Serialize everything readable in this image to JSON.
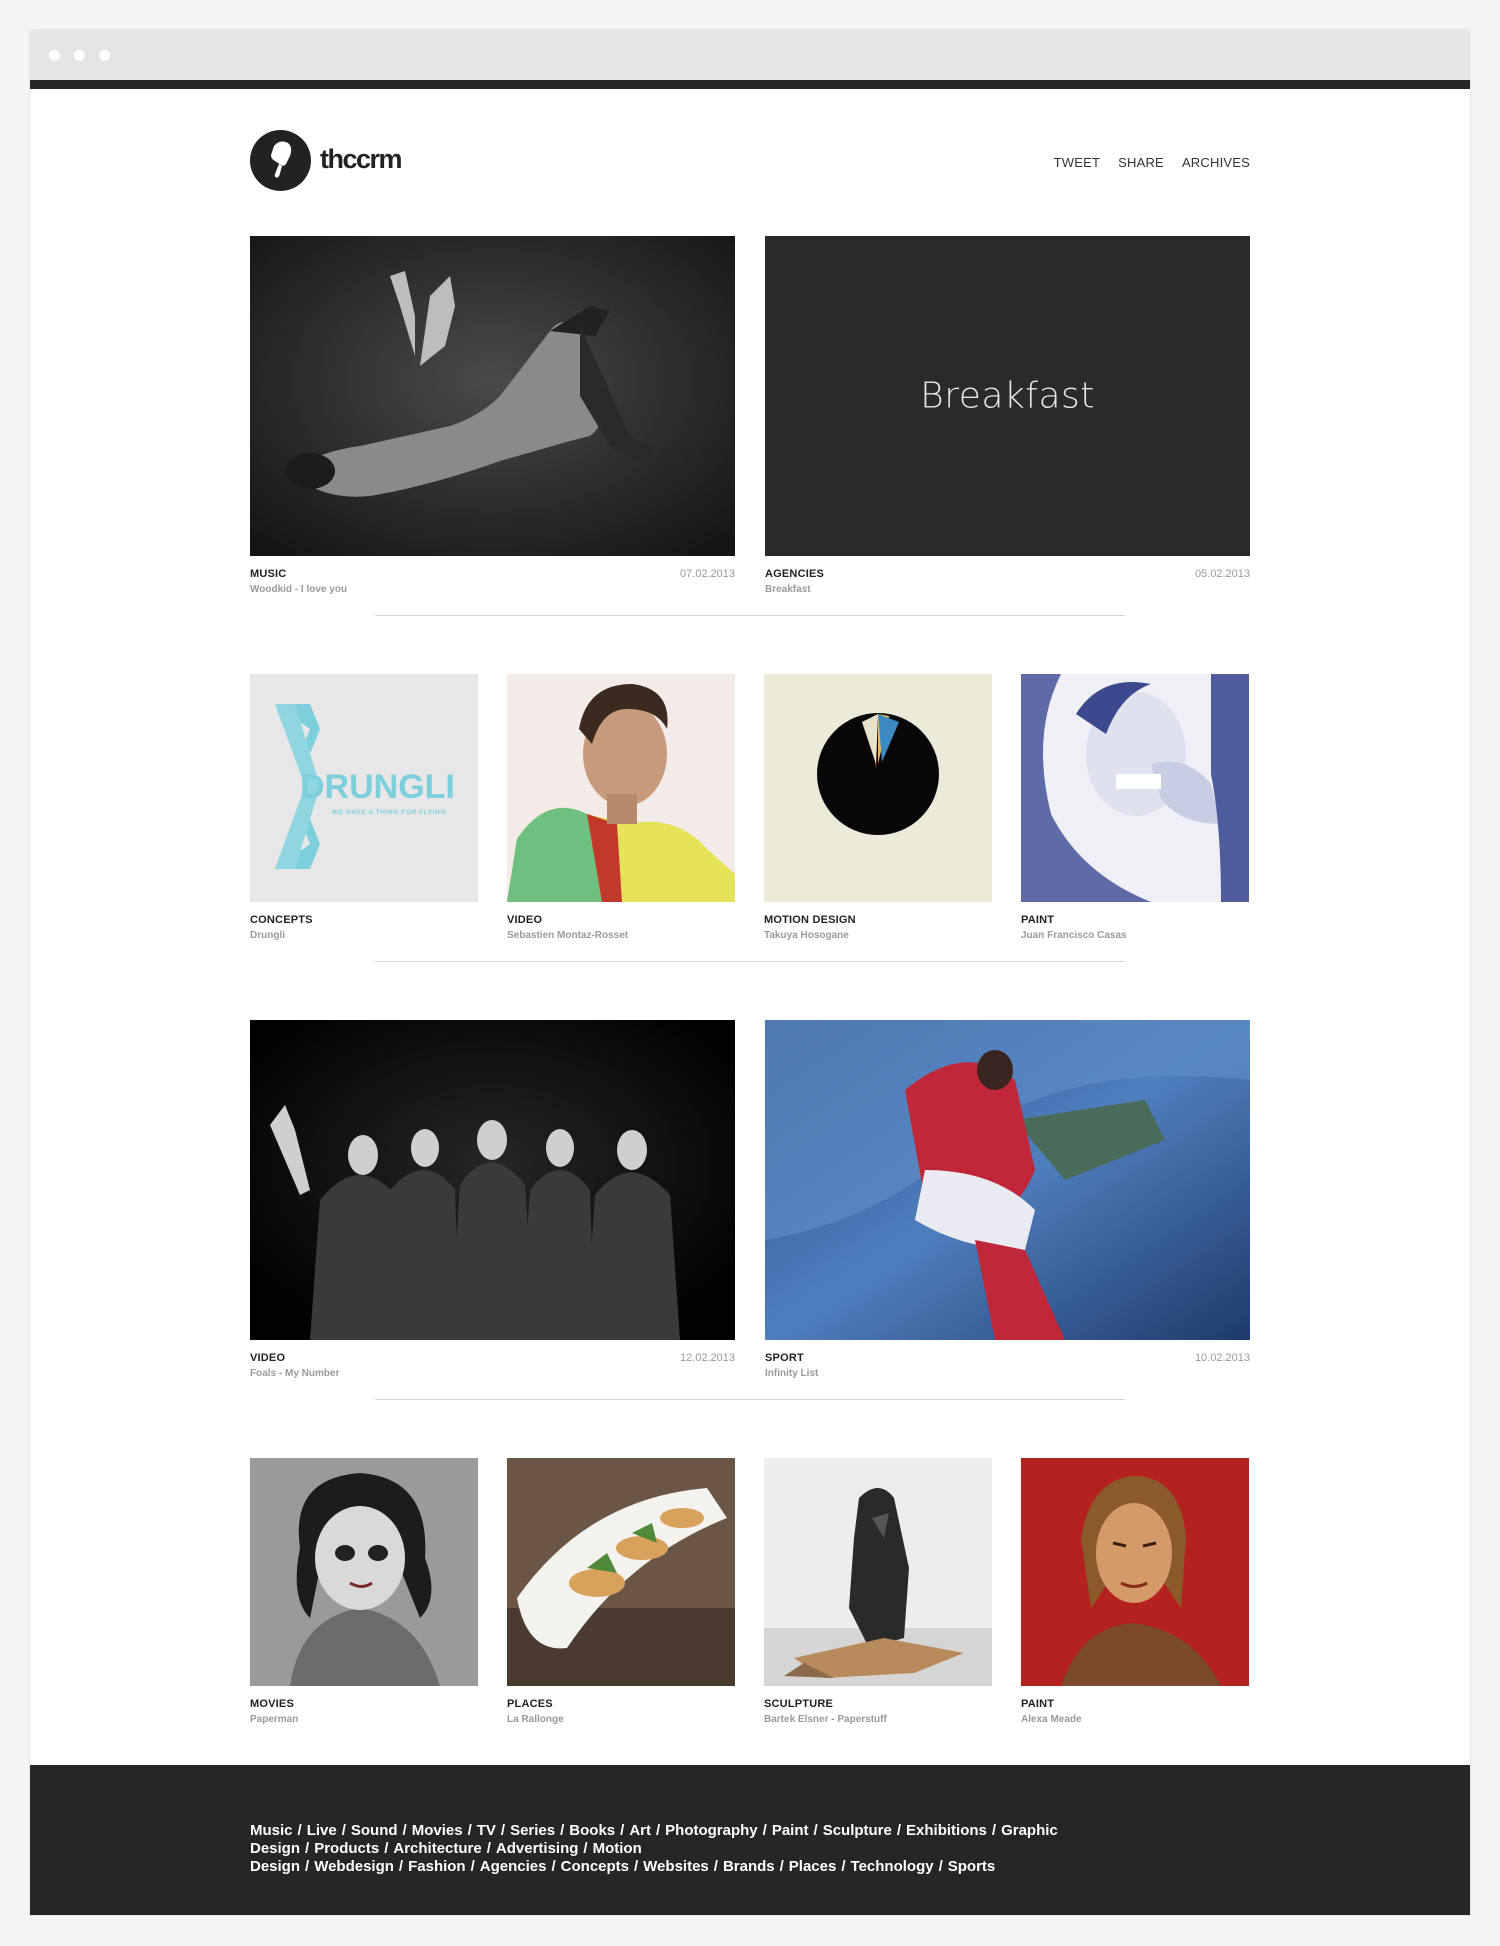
{
  "site": {
    "name": "thccrm"
  },
  "nav": [
    {
      "label": "TWEET"
    },
    {
      "label": "SHARE"
    },
    {
      "label": "ARCHIVES"
    }
  ],
  "posts": [
    {
      "category": "MUSIC",
      "title": "Woodkid - I love you",
      "date": "07.02.2013"
    },
    {
      "category": "AGENCIES",
      "title": "Breakfast",
      "date": "05.02.2013",
      "image_text": "Breakfast"
    },
    {
      "category": "CONCEPTS",
      "title": "Drungli",
      "logo_text": "DRUNGLI",
      "logo_tagline": "WE HAVE A THING FOR FLYING"
    },
    {
      "category": "VIDEO",
      "title": "Sebastien Montaz-Rosset"
    },
    {
      "category": "MOTION DESIGN",
      "title": "Takuya Hosogane"
    },
    {
      "category": "PAINT",
      "title": "Juan Francisco Casas"
    },
    {
      "category": "VIDEO",
      "title": "Foals - My Number",
      "date": "12.02.2013"
    },
    {
      "category": "SPORT",
      "title": "Infinity List",
      "date": "10.02.2013"
    },
    {
      "category": "MOVIES",
      "title": "Paperman"
    },
    {
      "category": "PLACES",
      "title": "La Rallonge"
    },
    {
      "category": "SCULPTURE",
      "title": "Bartek Elsner - Paperstuff"
    },
    {
      "category": "PAINT",
      "title": "Alexa Meade"
    }
  ],
  "footer_tags": [
    "Music",
    "Live",
    "Sound",
    "Movies",
    "TV",
    "Series",
    "Books",
    "Art",
    "Photography",
    "Paint",
    "Sculpture",
    "Exhibitions",
    "Graphic Design",
    "Products",
    "Architecture",
    "Advertising",
    "Motion Design",
    "Webdesign",
    "Fashion",
    "Agencies",
    "Concepts",
    "Websites",
    "Brands",
    "Places",
    "Technology",
    "Sports"
  ],
  "colors": {
    "dark": "#262626",
    "accent": "#7ecfdc",
    "muted": "#9a9a9a"
  }
}
